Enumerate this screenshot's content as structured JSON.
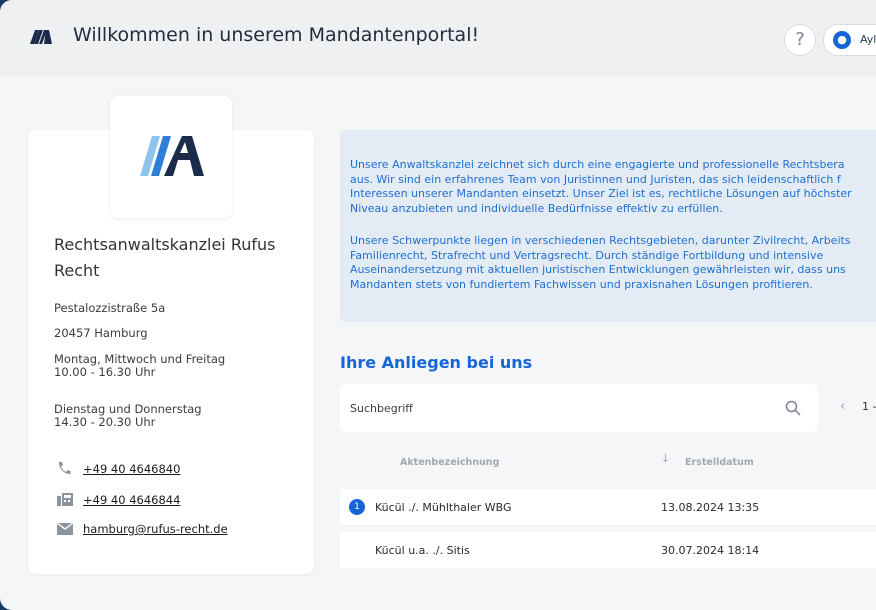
{
  "header": {
    "title": "Willkommen in unserem Mandantenportal!",
    "help_label": "?",
    "user_name": "Ayl"
  },
  "firm": {
    "name": "Rechtsanwaltskanzlei Rufus Recht",
    "street": "Pestalozzistraße 5a",
    "city": "20457 Hamburg",
    "hours": [
      {
        "days": "Montag, Mittwoch und Freitag",
        "time": "10.00 - 16.30 Uhr"
      },
      {
        "days": "Dienstag und Donnerstag",
        "time": "14.30 - 20.30 Uhr"
      }
    ],
    "phone": "+49 40 4646840",
    "fax": "+49 40 4646844",
    "email": "hamburg@rufus-recht.de"
  },
  "info": {
    "paragraph1": [
      "Unsere Anwaltskanzlei zeichnet sich durch eine engagierte und professionelle Rechtsbera",
      "aus. Wir sind ein erfahrenes Team von Juristinnen und Juristen, das sich leidenschaftlich f",
      "Interessen unserer Mandanten einsetzt. Unser Ziel ist es, rechtliche Lösungen auf höchster",
      "Niveau anzubieten und individuelle Bedürfnisse effektiv zu erfüllen."
    ],
    "paragraph2": [
      "Unsere Schwerpunkte liegen in verschiedenen Rechtsgebieten, darunter Zivilrecht, Arbeits",
      "Familienrecht, Strafrecht und Vertragsrecht. Durch ständige Fortbildung und intensive",
      "Auseinandersetzung mit aktuellen juristischen Entwicklungen gewährleisten wir, dass uns",
      "Mandanten stets von fundiertem Fachwissen und praxisnahen Lösungen profitieren."
    ]
  },
  "cases": {
    "title": "Ihre Anliegen bei uns",
    "search_placeholder": "Suchbegriff",
    "pager_text": "1 -",
    "columns": [
      "Aktenbezeichnung",
      "Erstelldatum"
    ],
    "rows": [
      {
        "badge": "1",
        "name": "Kücül ./. Mühlthaler WBG",
        "date": "13.08.2024 13:35"
      },
      {
        "badge": "",
        "name": "Kücül u.a. ./. Sitis",
        "date": "30.07.2024 18:14"
      }
    ]
  },
  "colors": {
    "accent": "#1665d8",
    "background": "#17395f",
    "info_bg": "#e3ebf5"
  },
  "icons": [
    "logo-icon",
    "help-icon",
    "user-icon",
    "search-icon",
    "chevron-left-icon",
    "sort-arrow-icon",
    "phone-icon",
    "fax-icon",
    "mail-icon"
  ]
}
